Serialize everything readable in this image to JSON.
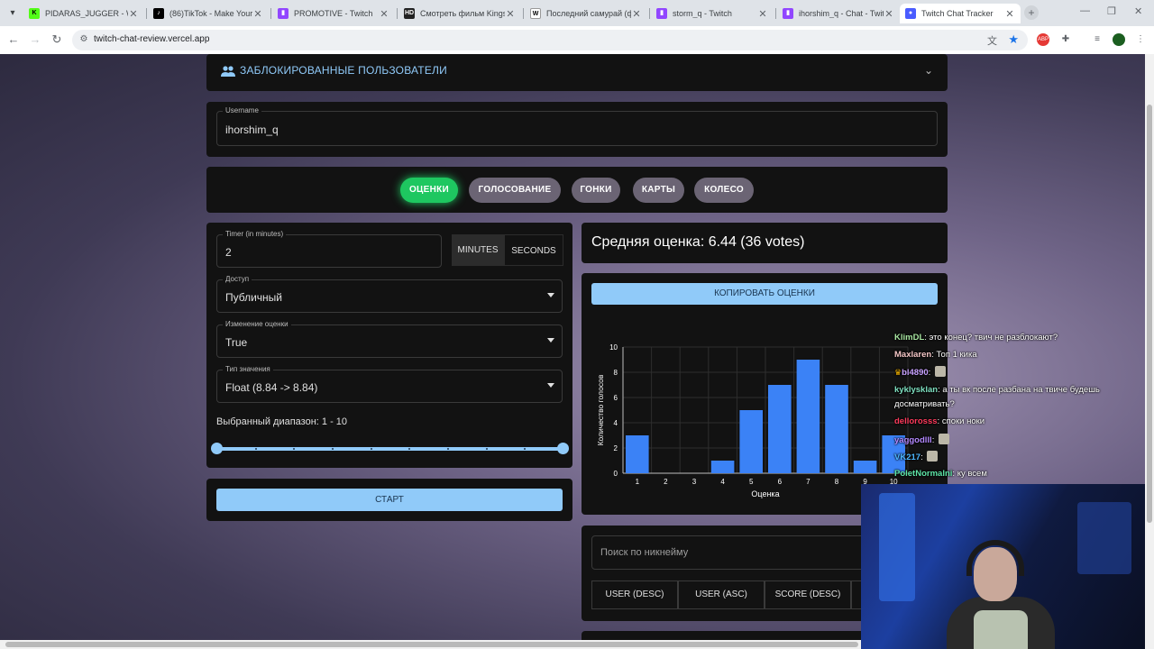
{
  "browser": {
    "tabs": [
      {
        "title": "PIDARAS_JUGGER - Watc",
        "favicon": "kick-icon",
        "color": "#53fc18"
      },
      {
        "title": "(86)TikTok - Make Your Da",
        "favicon": "tiktok-icon",
        "color": "#000000"
      },
      {
        "title": "PROMOTIVE - Twitch",
        "favicon": "twitch-icon",
        "color": "#9146ff"
      },
      {
        "title": "Смотреть фильм Kingsm",
        "favicon": "hd-icon",
        "color": "#222222"
      },
      {
        "title": "Последний самурай (фи",
        "favicon": "wikipedia-icon",
        "color": "#ffffff"
      },
      {
        "title": "storm_q - Twitch",
        "favicon": "twitch-icon",
        "color": "#9146ff"
      },
      {
        "title": "ihorshim_q - Chat - Twitc",
        "favicon": "twitch-icon",
        "color": "#9146ff"
      },
      {
        "title": "Twitch Chat Tracker",
        "favicon": "app-icon",
        "color": "#4a5cff",
        "active": true
      }
    ],
    "url": "twitch-chat-review.vercel.app"
  },
  "accordion": {
    "title": "ЗАБЛОКИРОВАННЫЕ ПОЛЬЗОВАТЕЛИ",
    "icon": "people-icon"
  },
  "username": {
    "label": "Username",
    "value": "ihorshim_q"
  },
  "modes": [
    {
      "label": "ОЦЕНКИ",
      "active": true
    },
    {
      "label": "ГОЛОСОВАНИЕ"
    },
    {
      "label": "ГОНКИ"
    },
    {
      "label": "КАРТЫ"
    },
    {
      "label": "КОЛЕСО"
    }
  ],
  "settings": {
    "timer": {
      "label": "Timer (in minutes)",
      "value": "2"
    },
    "units": {
      "minutes": "MINUTES",
      "seconds": "SECONDS",
      "selected": "minutes"
    },
    "access": {
      "label": "Доступ",
      "value": "Публичный"
    },
    "change": {
      "label": "Изменение оценки",
      "value": "True"
    },
    "type": {
      "label": "Тип значения",
      "value": "Float (8.84 -> 8.84)"
    },
    "range": {
      "label": "Выбранный диапазон: 1 - 10",
      "min": 1,
      "max": 10,
      "low": 1,
      "high": 10
    }
  },
  "start_label": "СТАРТ",
  "average_title": "Средняя оценка: 6.44 (36 votes)",
  "copy_label": "КОПИРОВАТЬ ОЦЕНКИ",
  "chart_data": {
    "type": "bar",
    "categories": [
      "1",
      "2",
      "3",
      "4",
      "5",
      "6",
      "7",
      "8",
      "9",
      "10"
    ],
    "values": [
      3,
      0,
      0,
      1,
      5,
      7,
      9,
      7,
      1,
      3
    ],
    "xlabel": "Оценка",
    "ylabel": "Количество голосов",
    "ylim": [
      0,
      10
    ],
    "yticks": [
      0,
      2,
      4,
      6,
      8,
      10
    ],
    "bar_color": "#3b82f6",
    "grid": true
  },
  "search": {
    "placeholder": "Поиск по никнейму"
  },
  "sort_buttons": [
    "USER (DESC)",
    "USER (ASC)",
    "SCORE (DESC)"
  ],
  "chat_overlay": [
    {
      "user": "KlimDL",
      "color": "#a8e6a1",
      "text": "это конец? твич не разблокают?"
    },
    {
      "user": "Maxlaren",
      "color": "#f4c6c6",
      "text": "Топ 1 кика"
    },
    {
      "user": "bl4890",
      "color": "#c8a2ff",
      "text": "",
      "emote": true,
      "crown": true
    },
    {
      "user": "kyklysklan",
      "color": "#7ee0c0",
      "text": "а ты вк после разбана на твиче будешь"
    },
    {
      "user": "",
      "color": "#ffffff",
      "text": "досматривать?"
    },
    {
      "user": "dellorosss",
      "color": "#ff3b5c",
      "text": "споки ноки"
    },
    {
      "user": "yaggodlll",
      "color": "#b388ff",
      "text": "",
      "emote": true
    },
    {
      "user": "VK217",
      "color": "#4db6ff",
      "text": "",
      "emote": true
    },
    {
      "user": "PoletNormalni",
      "color": "#5ee6a8",
      "text": "ку всем"
    }
  ]
}
